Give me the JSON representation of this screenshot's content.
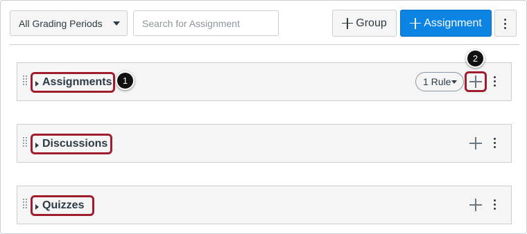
{
  "toolbar": {
    "grading_period": "All Grading Periods",
    "search_placeholder": "Search for Assignment",
    "group_button": "Group",
    "assignment_button": "Assignment"
  },
  "groups": [
    {
      "name": "Assignments",
      "rule_label": "1 Rule"
    },
    {
      "name": "Discussions"
    },
    {
      "name": "Quizzes"
    }
  ],
  "callouts": [
    "1",
    "2"
  ],
  "colors": {
    "accent": "#0b84e3",
    "highlight": "#a01c2f",
    "callout": "#111111"
  },
  "icons": [
    "plus-icon",
    "kebab-menu-icon",
    "drag-handle-icon",
    "expand-triangle-icon",
    "caret-down-icon"
  ]
}
